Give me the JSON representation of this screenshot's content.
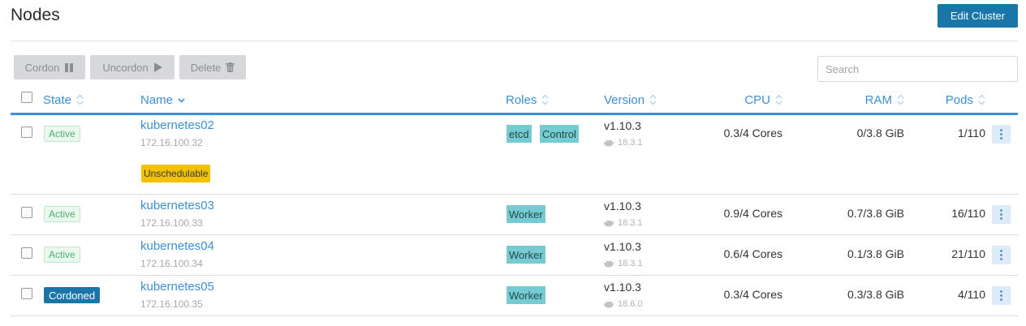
{
  "page": {
    "title": "Nodes",
    "edit_cluster_label": "Edit Cluster"
  },
  "toolbar": {
    "cordon_label": "Cordon",
    "uncordon_label": "Uncordon",
    "delete_label": "Delete",
    "search_placeholder": "Search"
  },
  "table": {
    "columns": {
      "state": "State",
      "name": "Name",
      "roles": "Roles",
      "version": "Version",
      "cpu": "CPU",
      "ram": "RAM",
      "pods": "Pods"
    },
    "rows": [
      {
        "state": "Active",
        "name": "kubernetes02",
        "ip": "172.16.100.32",
        "extra_badge": "Unschedulable",
        "roles": [
          "etcd",
          "Control"
        ],
        "version": "v1.10.3",
        "docker": "18.3.1",
        "cpu": "0.3/4 Cores",
        "ram": "0/3.8 GiB",
        "pods": "1/110"
      },
      {
        "state": "Active",
        "name": "kubernetes03",
        "ip": "172.16.100.33",
        "roles": [
          "Worker"
        ],
        "version": "v1.10.3",
        "docker": "18.3.1",
        "cpu": "0.9/4 Cores",
        "ram": "0.7/3.8 GiB",
        "pods": "16/110"
      },
      {
        "state": "Active",
        "name": "kubernetes04",
        "ip": "172.16.100.34",
        "roles": [
          "Worker"
        ],
        "version": "v1.10.3",
        "docker": "18.3.1",
        "cpu": "0.6/4 Cores",
        "ram": "0.1/3.8 GiB",
        "pods": "21/110"
      },
      {
        "state": "Cordoned",
        "name": "kubernetes05",
        "ip": "172.16.100.35",
        "roles": [
          "Worker"
        ],
        "version": "v1.10.3",
        "docker": "18.6.0",
        "cpu": "0.3/4 Cores",
        "ram": "0.3/3.8 GiB",
        "pods": "4/110"
      }
    ]
  },
  "colors": {
    "primary": "#1a75a8",
    "link": "#3d8fd1",
    "active": "#4caf74",
    "role": "#76cbd3",
    "warning": "#f2c200"
  },
  "icons": {
    "cordon": "pause-icon",
    "uncordon": "play-icon",
    "delete": "trash-icon",
    "sort": "sort-icon",
    "sort_desc": "sort-desc-icon",
    "docker": "docker-icon",
    "actions": "kebab-icon"
  }
}
